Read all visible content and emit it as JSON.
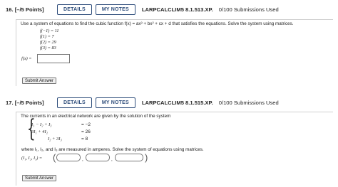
{
  "q16": {
    "number": "16.",
    "points": "[–/5 Points]",
    "details_label": "DETAILS",
    "notes_label": "MY NOTES",
    "code": "LARPCALCLIM5 8.1.513.XP.",
    "submissions": "0/100 Submissions Used",
    "prompt": "Use a system of equations to find the cubic function f(x) = ax³ + bx² + cx + d that satisfies the equations. Solve the system using matrices.",
    "conditions": [
      "f(−1) = 11",
      "f(1) = 7",
      "f(2) = 29",
      "f(3) = 83"
    ],
    "answer_label": "f(x) =",
    "answer_value": "",
    "submit_label": "Submit Answer"
  },
  "q17": {
    "number": "17.",
    "points": "[–/5 Points]",
    "details_label": "DETAILS",
    "notes_label": "MY NOTES",
    "code": "LARPCALCLIM5 8.1.515.XP.",
    "submissions": "0/100 Submissions Used",
    "prompt": "The currents in an electrical network are given by the solution of the system",
    "system": [
      {
        "lhs": "I₁ −  I₂ +  I₃",
        "rhs": "= −2"
      },
      {
        "lhs": "3I₁ + 4I₂",
        "rhs": "= 26"
      },
      {
        "lhs": "I₂ + 3I₃",
        "rhs": "= 8"
      }
    ],
    "where_text": "where I₁, I₂, and I₃ are measured in amperes. Solve the system of equations using matrices.",
    "tuple_label": "(I₁, I₂, I₃) =",
    "answers": [
      "",
      "",
      ""
    ],
    "submit_label": "Submit Answer"
  }
}
